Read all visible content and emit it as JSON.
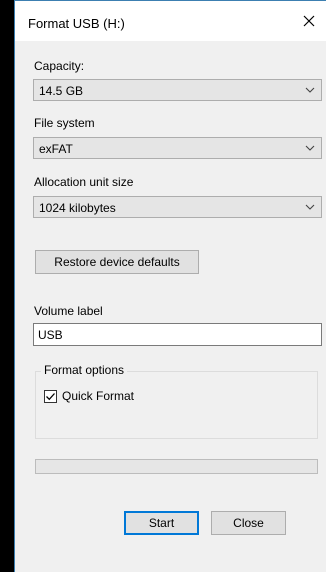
{
  "window": {
    "title": "Format USB (H:)"
  },
  "capacity": {
    "label": "Capacity:",
    "value": "14.5 GB"
  },
  "file_system": {
    "label": "File system",
    "value": "exFAT"
  },
  "allocation": {
    "label": "Allocation unit size",
    "value": "1024 kilobytes"
  },
  "restore_label": "Restore device defaults",
  "volume": {
    "label": "Volume label",
    "value": "USB"
  },
  "format_options": {
    "legend": "Format options",
    "quick_format": {
      "label": "Quick Format",
      "checked": true
    }
  },
  "progress": {
    "fraction": 0
  },
  "buttons": {
    "start": "Start",
    "close": "Close"
  },
  "colors": {
    "background": "#000000",
    "window": "#f0f0f0",
    "accent": "#0078d7",
    "progress": "#06b025"
  },
  "icons": {
    "close": "close-icon",
    "dropdown": "chevron-down-icon",
    "check": "checkmark-icon"
  }
}
